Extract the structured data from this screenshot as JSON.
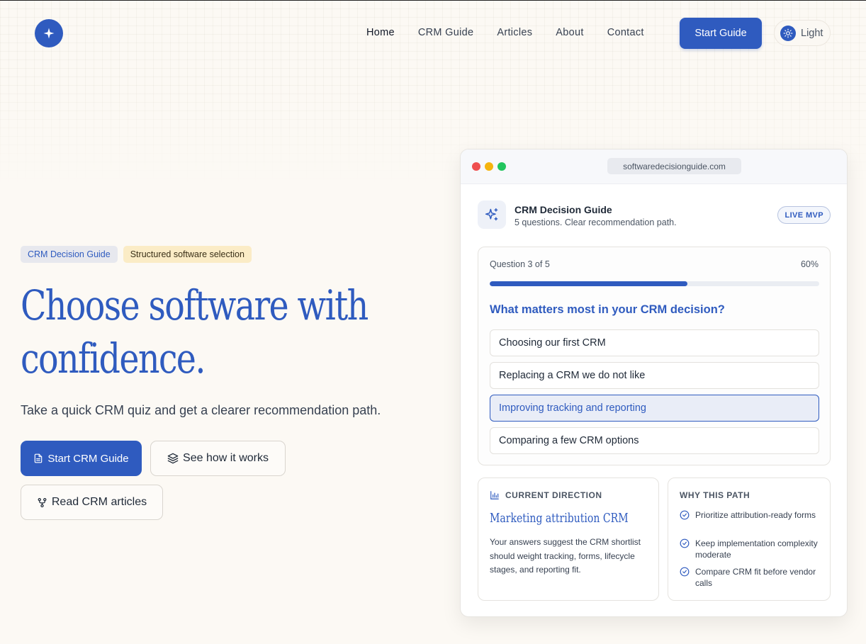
{
  "nav": {
    "items": [
      {
        "label": "Home",
        "active": true
      },
      {
        "label": "CRM Guide"
      },
      {
        "label": "Articles"
      },
      {
        "label": "About"
      },
      {
        "label": "Contact"
      }
    ],
    "start_guide_label": "Start Guide",
    "theme_label": "Light",
    "logo_icon": "sparkle-icon"
  },
  "hero": {
    "chips": [
      "CRM Decision Guide",
      "Structured software selection"
    ],
    "title_line1": "Choose software with",
    "title_line2": "confidence.",
    "subtitle": "Take a quick CRM quiz and get a clearer recommendation path.",
    "cta_primary": "Start CRM Guide",
    "cta_secondary": "See how it works",
    "cta_tertiary": "Read CRM articles"
  },
  "preview": {
    "url": "softwaredecisionguide.com",
    "app_title": "CRM Decision Guide",
    "app_desc": "5 questions. Clear recommendation path.",
    "badge": "LIVE MVP",
    "quiz": {
      "count": "Question 3 of 5",
      "percent_label": "60%",
      "progress": 0.6,
      "question": "What matters most in your CRM decision?",
      "options": [
        "Choosing our first CRM",
        "Replacing a CRM we do not like",
        "Improving tracking and reporting",
        "Comparing a few CRM options"
      ],
      "selected_index": 2
    },
    "direction": {
      "label": "CURRENT DIRECTION",
      "value": "Marketing attribution CRM",
      "desc": "Your answers suggest the CRM shortlist should weight tracking, forms, lifecycle stages, and reporting fit."
    },
    "why": {
      "label": "WHY THIS PATH",
      "items": [
        "Prioritize attribution-ready forms",
        "Keep implementation complexity moderate",
        "Compare CRM fit before vendor calls"
      ]
    }
  },
  "colors": {
    "accent": "#2f5bbf",
    "background": "#fcf9f4",
    "chip_amber": "#fbecc6",
    "dot_red": "#ef4f4f",
    "dot_yellow": "#f5b40e",
    "dot_green": "#22c55e"
  }
}
